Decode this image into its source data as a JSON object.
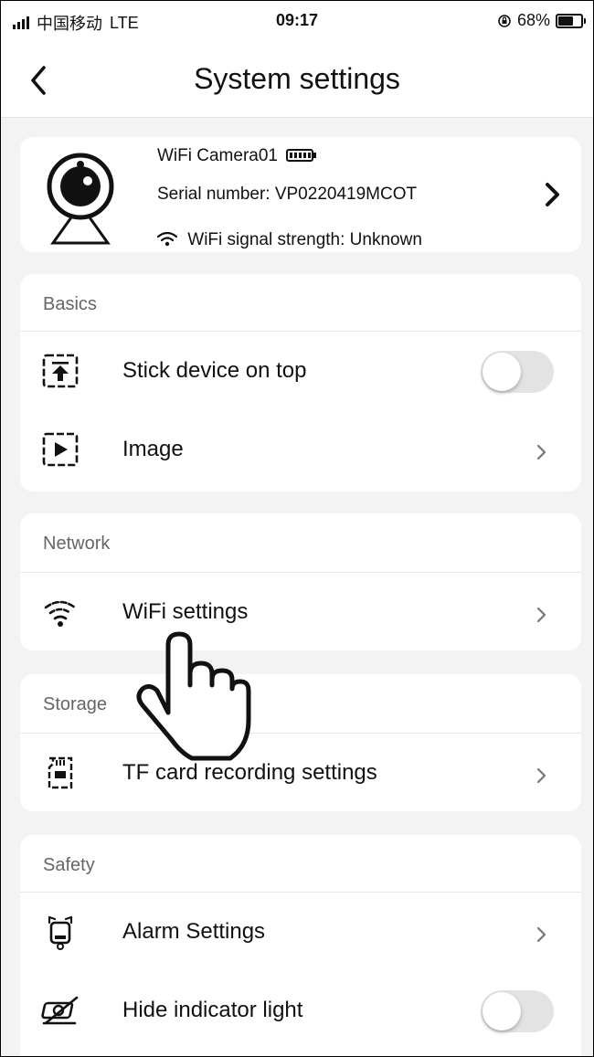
{
  "status_bar": {
    "carrier": "中国移动",
    "network": "LTE",
    "time": "09:17",
    "battery_percent": "68%"
  },
  "nav": {
    "title": "System settings"
  },
  "device": {
    "name": "WiFi Camera01",
    "serial": "Serial number: VP0220419MCOT",
    "wifi_signal": "WiFi signal strength: Unknown"
  },
  "sections": {
    "basics": {
      "title": "Basics",
      "stick_label": "Stick device on top",
      "stick_enabled": false,
      "image_label": "Image"
    },
    "network": {
      "title": "Network",
      "wifi_label": "WiFi settings"
    },
    "storage": {
      "title": "Storage",
      "tf_label": "TF card recording settings"
    },
    "safety": {
      "title": "Safety",
      "alarm_label": "Alarm Settings",
      "hide_light_label": "Hide indicator light",
      "hide_light_enabled": false
    }
  },
  "icons": [
    "back-arrow-icon",
    "camera-icon",
    "battery-icon",
    "wifi-icon",
    "chevron-right-icon",
    "pin-top-icon",
    "play-icon",
    "wifi-signal-icon",
    "sd-card-icon",
    "alarm-icon",
    "light-off-icon",
    "pointing-hand-icon"
  ]
}
